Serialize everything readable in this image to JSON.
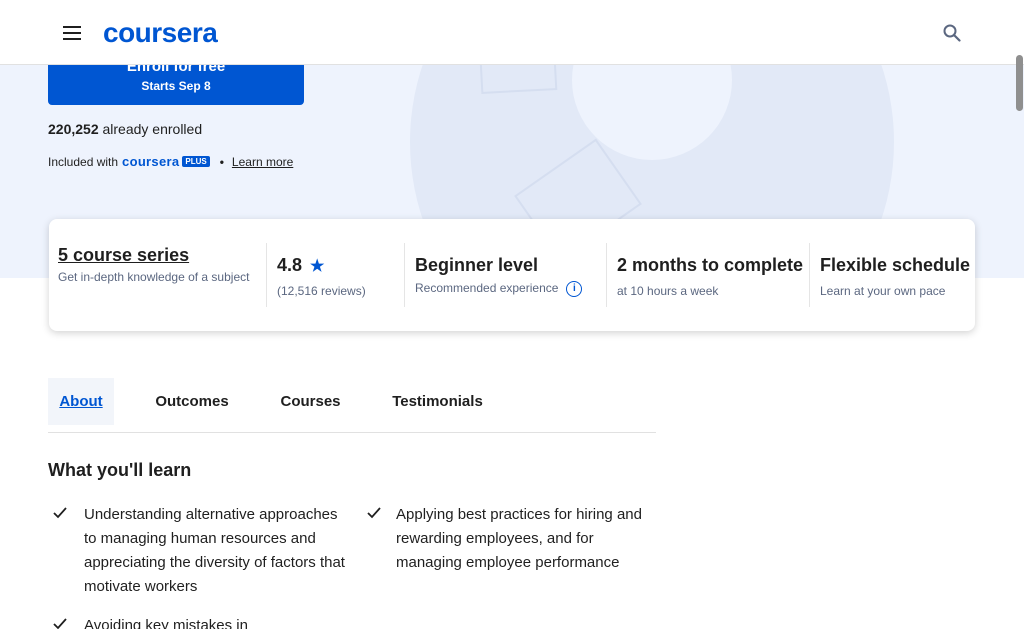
{
  "header": {
    "logo": "coursera",
    "menu_icon": "menu-icon",
    "search_icon": "search-icon"
  },
  "hero": {
    "enroll_label": "Enroll for free",
    "start_label": "Starts Sep 8",
    "enrolled_count": "220,252",
    "enrolled_suffix": " already enrolled",
    "included_prefix": "Included with ",
    "plus_logo": "coursera",
    "plus_badge": "PLUS",
    "dot": "•",
    "learn_more": "Learn more"
  },
  "stats": {
    "series": {
      "title": "5 course series",
      "subtitle": "Get in-depth knowledge of a subject"
    },
    "rating": {
      "value": "4.8",
      "star": "★",
      "reviews": "(12,516 reviews)"
    },
    "level": {
      "title": "Beginner level",
      "subtitle": "Recommended experience",
      "info_icon": "i"
    },
    "duration": {
      "title": "2 months to complete",
      "subtitle": "at 10 hours a week"
    },
    "schedule": {
      "title": "Flexible schedule",
      "subtitle": "Learn at your own pace"
    }
  },
  "tabs": [
    {
      "label": "About"
    },
    {
      "label": "Outcomes"
    },
    {
      "label": "Courses"
    },
    {
      "label": "Testimonials"
    }
  ],
  "learn": {
    "title": "What you'll learn",
    "items": [
      "Understanding alternative approaches to managing human resources and appreciating the diversity of factors that motivate workers",
      "Applying best practices for hiring and rewarding employees, and for managing employee performance",
      "Avoiding key mistakes in"
    ]
  },
  "colors": {
    "brand": "#0056d2",
    "hero_bg": "#eef3fd"
  }
}
